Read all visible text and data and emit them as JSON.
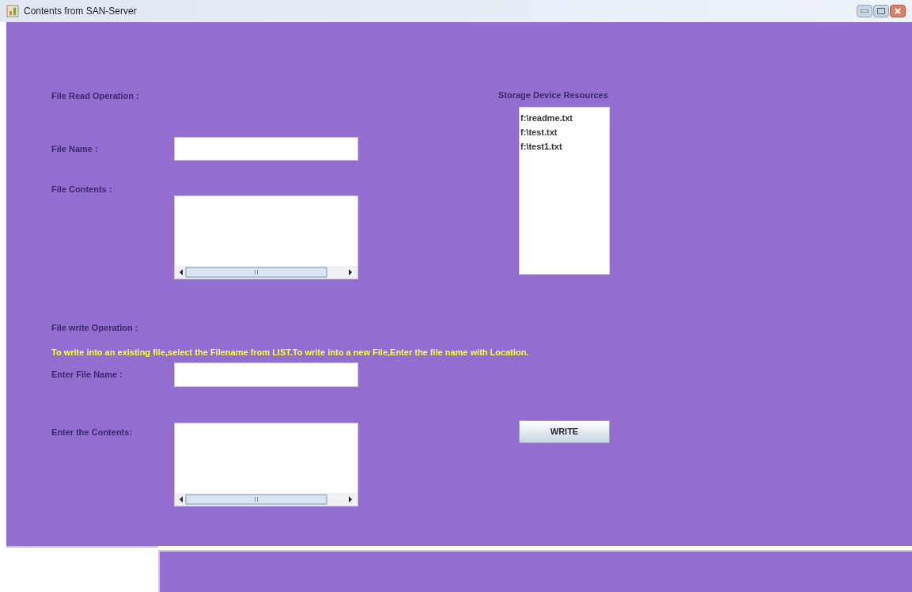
{
  "window": {
    "title": "Contents from SAN-Server"
  },
  "read_section": {
    "heading": "File Read Operation :",
    "file_name_label": "File Name :",
    "file_contents_label": "File Contents :"
  },
  "resources": {
    "heading": "Storage Device Resources",
    "items": [
      "f:\\readme.txt",
      "f:\\test.txt",
      "f:\\test1.txt"
    ]
  },
  "write_section": {
    "heading": "File write Operation :",
    "instruction": "To write into an existing file,select the Filename from LIST.To write into a new File,Enter the file name with Location.",
    "file_name_label": "Enter File Name :",
    "contents_label": "Enter the Contents:",
    "button": "WRITE"
  }
}
